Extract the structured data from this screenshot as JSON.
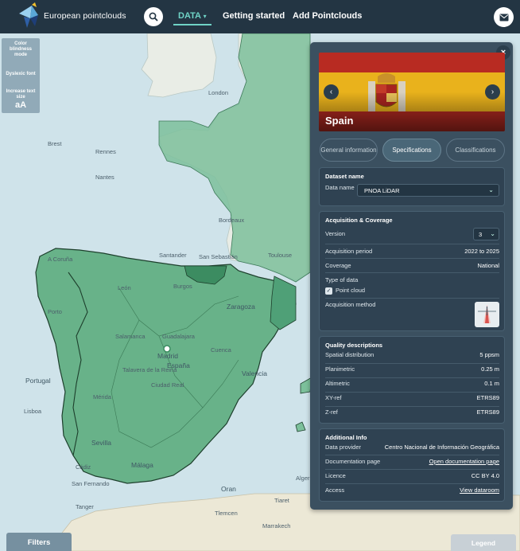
{
  "nav": {
    "brand": "European pointclouds",
    "data_label": "DATA",
    "data_caret": "▾",
    "getting_started": "Getting started",
    "add_pointclouds": "Add Pointclouds"
  },
  "accessibility": {
    "color_blindness": "Color blindness mode",
    "dyslexic": "Dyslexic font",
    "increase_text": "Increase text size",
    "aa": "aA"
  },
  "map": {
    "labels": [
      "London",
      "Brest",
      "Rennes",
      "Nantes",
      "Bordeaux",
      "Santander",
      "San Sebastián",
      "Toulouse",
      "A Coruña",
      "León",
      "Burgos",
      "Zaragoza",
      "Porto",
      "Salamanca",
      "Guadalajara",
      "Madrid",
      "España",
      "Talavera de la Reina",
      "Ciudad Real",
      "Cuenca",
      "Valencia",
      "Mérida",
      "Portugal",
      "Lisboa",
      "Sevilla",
      "Málaga",
      "Cádiz",
      "San Fernando",
      "Tanger",
      "Oran",
      "Alger",
      "Tiaret",
      "Tlemcen",
      "Marrakech"
    ]
  },
  "panel": {
    "country": "Spain",
    "prev": "‹",
    "next": "›",
    "close": "×",
    "tabs": [
      "General information",
      "Specifications",
      "Classifications"
    ],
    "dataset": {
      "title": "Dataset name",
      "name_label": "Data name",
      "name_value": "PNOA LiDAR"
    },
    "acquisition": {
      "title": "Acquisition & Coverage",
      "version_label": "Version",
      "version_value": "3",
      "period_label": "Acquisition period",
      "period_value": "2022 to 2025",
      "coverage_label": "Coverage",
      "coverage_value": "National",
      "type_label": "Type of data",
      "type_value": "Point cloud",
      "method_label": "Acquisition method"
    },
    "quality": {
      "title": "Quality descriptions",
      "rows": [
        {
          "k": "Spatial distribution",
          "v": "5 ppsm"
        },
        {
          "k": "Planimetric",
          "v": "0.25 m"
        },
        {
          "k": "Altimetric",
          "v": "0.1 m"
        },
        {
          "k": "XY-ref",
          "v": "ETRS89"
        },
        {
          "k": "Z-ref",
          "v": "ETRS89"
        }
      ]
    },
    "additional": {
      "title": "Additional Info",
      "rows": [
        {
          "k": "Data provider",
          "v": "Centro Nacional de Información Geográfica"
        },
        {
          "k": "Documentation page",
          "v": "Open documentation page"
        },
        {
          "k": "Licence",
          "v": "CC BY 4.0"
        },
        {
          "k": "Access",
          "v": "View dataroom"
        }
      ]
    }
  },
  "buttons": {
    "filters": "Filters",
    "legend": "Legend"
  },
  "colors": {
    "nav_bg": "#233543",
    "accent": "#6fd3c6",
    "land": "#5fae80",
    "sea": "#cfe3ea",
    "panel": "#3b5060"
  }
}
